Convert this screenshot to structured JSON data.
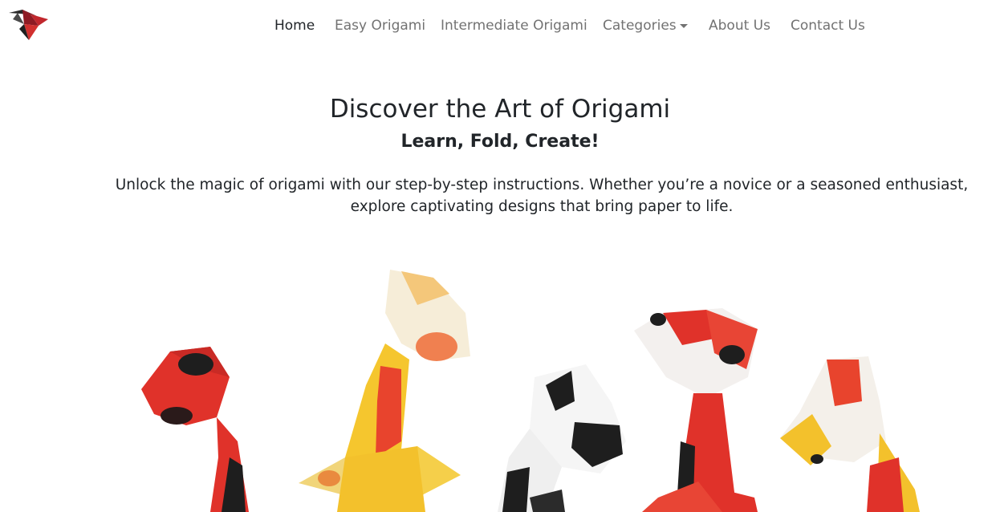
{
  "brand": {
    "logo_icon": "origami-bird-logo"
  },
  "nav": {
    "items": [
      {
        "label": "Home",
        "active": true
      },
      {
        "label": "Easy Origami",
        "active": false
      },
      {
        "label": "Intermediate Origami",
        "active": false
      },
      {
        "label": "Categories",
        "active": false,
        "dropdown": true
      },
      {
        "label": "About Us",
        "active": false
      },
      {
        "label": "Contact Us",
        "active": false
      }
    ],
    "colors": {
      "active": "#212529",
      "inactive": "#727272"
    }
  },
  "hero": {
    "title": "Discover the Art of Origami",
    "subtitle": "Learn, Fold, Create!",
    "text": "Unlock the magic of origami with our step-by-step instructions. Whether you’re a novice or a seasoned enthusiast, explore captivating designs that bring paper to life.",
    "image_icon": "origami-koi-fish-image"
  },
  "colors": {
    "background": "#ffffff",
    "text": "#212529",
    "koi_red": "#e53a25",
    "koi_black": "#1e1e1e",
    "koi_yellow": "#f3c12c"
  }
}
